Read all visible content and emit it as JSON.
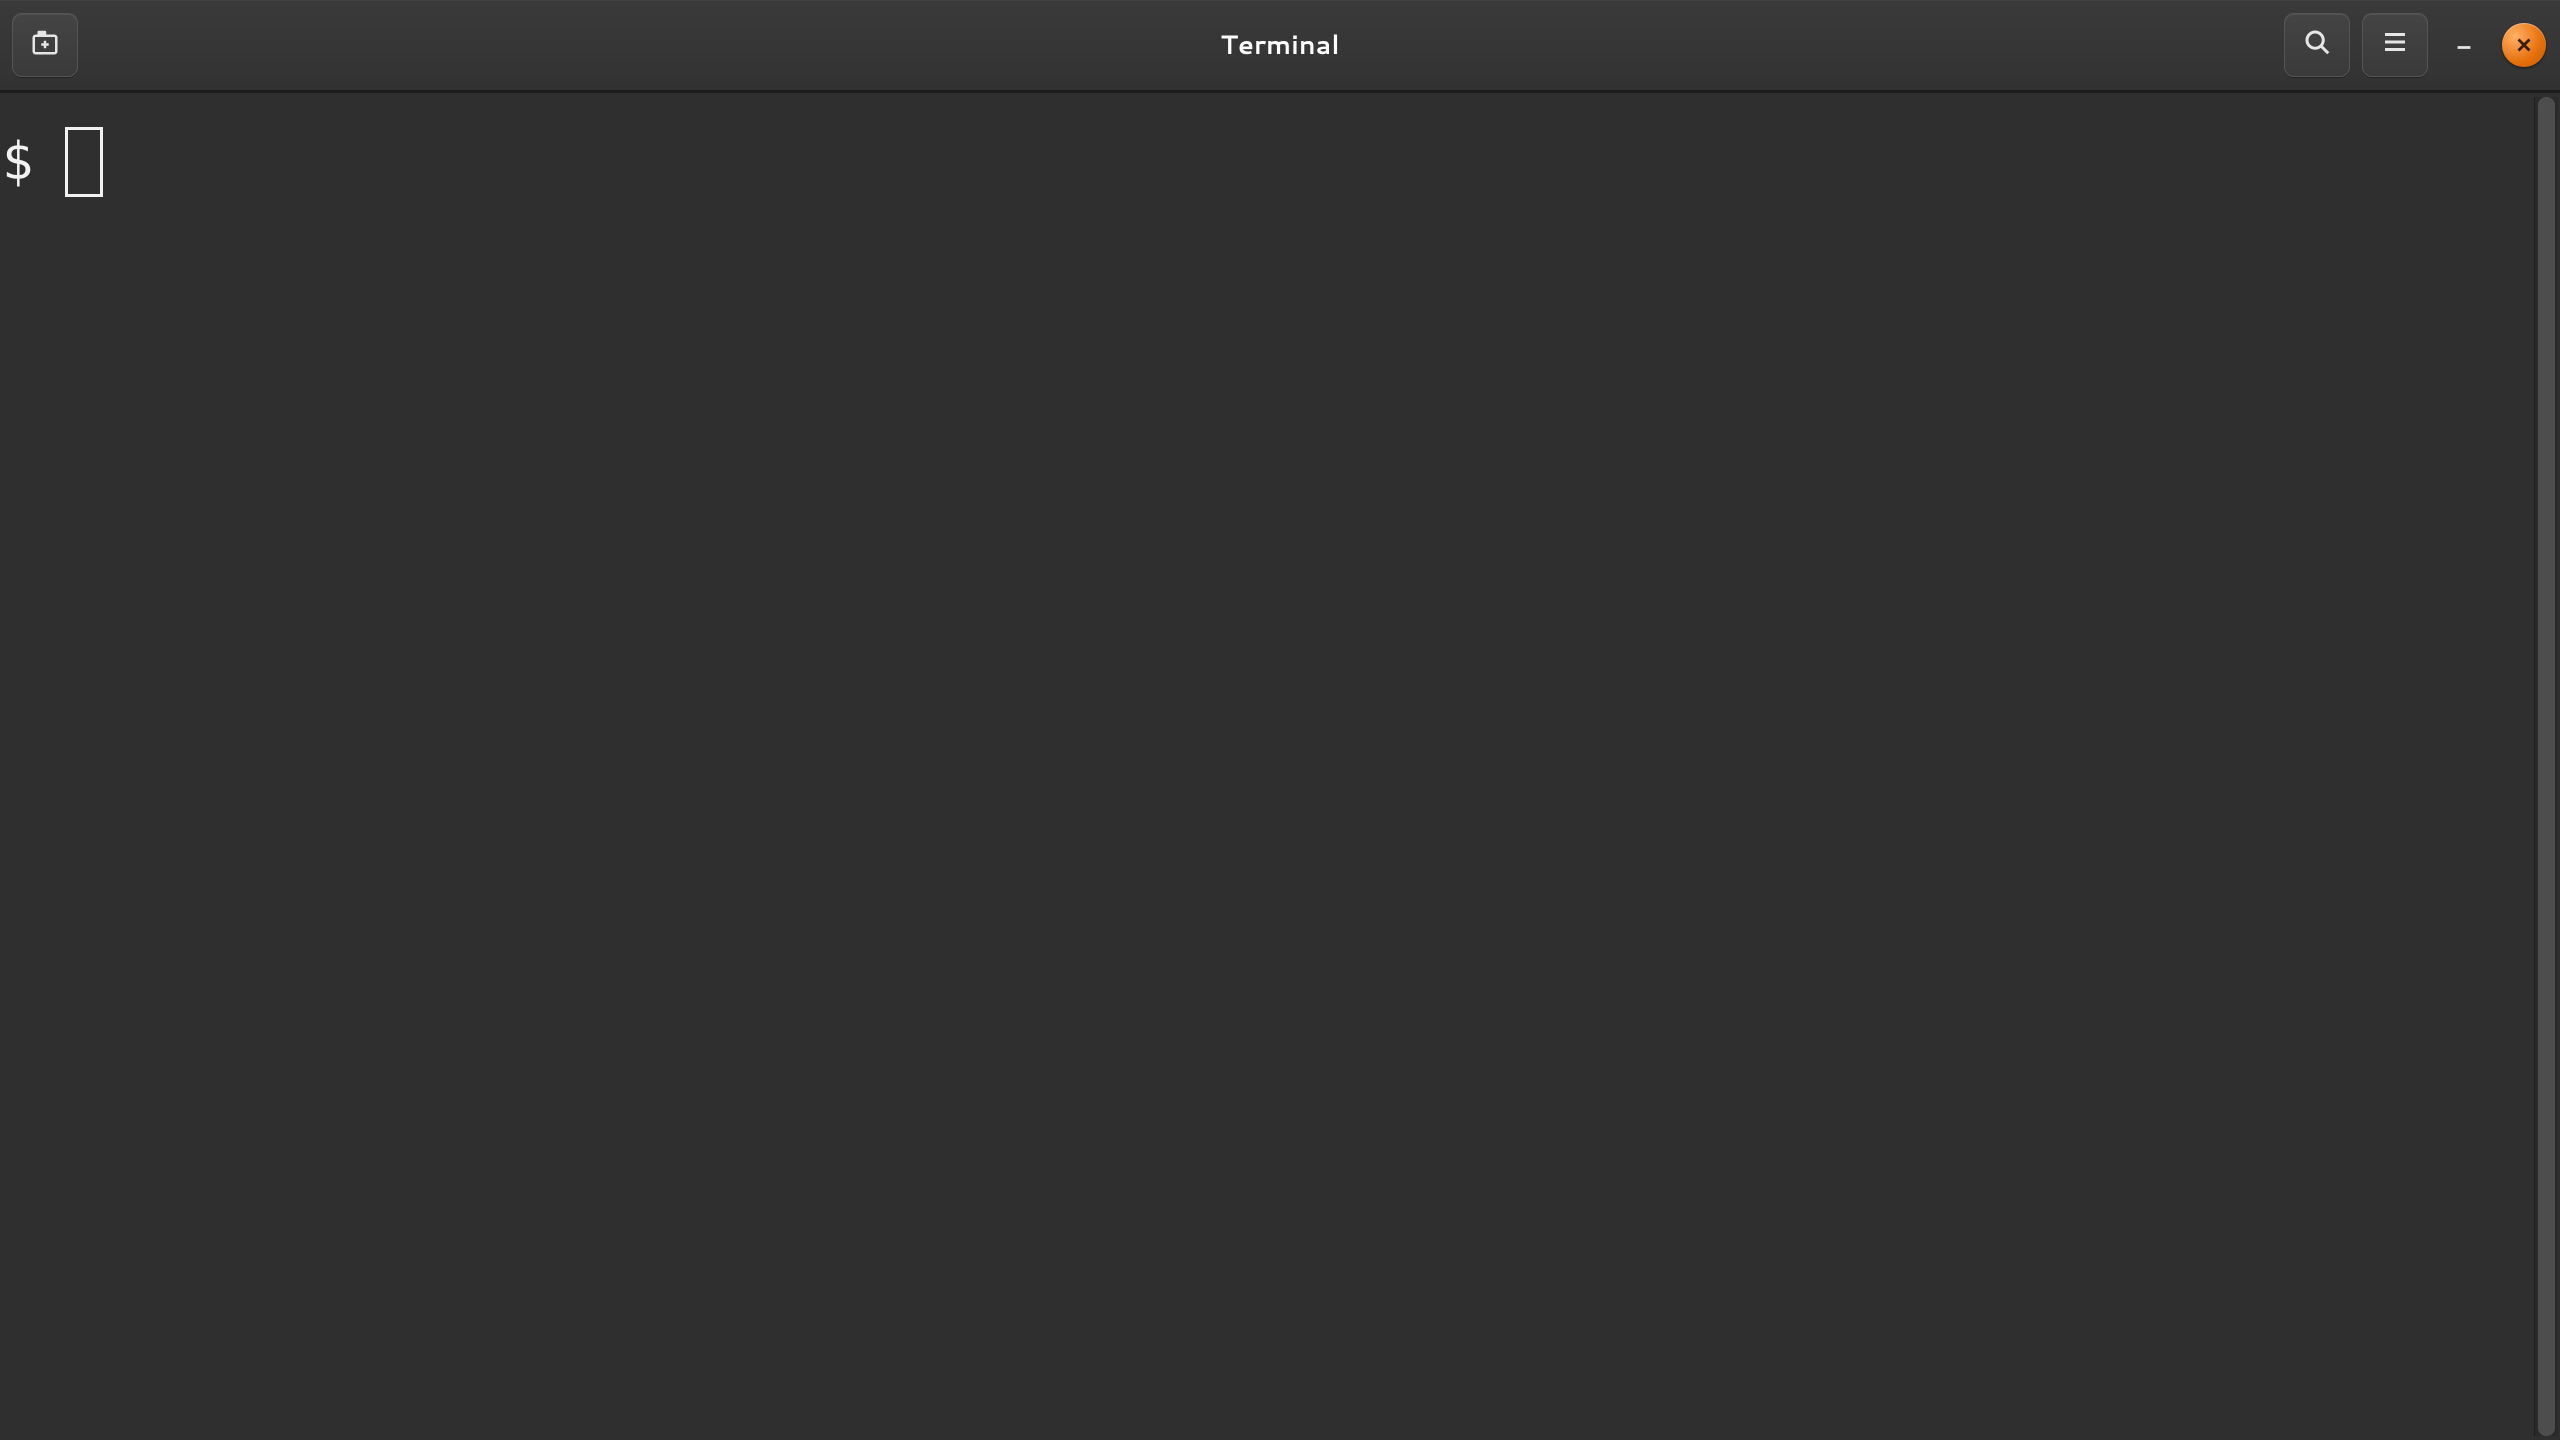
{
  "header": {
    "title": "Terminal",
    "icons": {
      "new_tab": "new-tab-icon",
      "search": "search-icon",
      "menu": "hamburger-menu-icon",
      "minimize": "minimize-icon",
      "close": "close-icon"
    }
  },
  "terminal": {
    "prompt": "$",
    "input_value": "",
    "cursor_style": "outline-block"
  },
  "scrollbar": {
    "thumb_top_pct": 0,
    "thumb_height_pct": 100
  },
  "colors": {
    "headerbar_bg": "#333333",
    "terminal_bg": "#2f2f2f",
    "text": "#f2f2f2",
    "close_accent": "#e6700b"
  }
}
